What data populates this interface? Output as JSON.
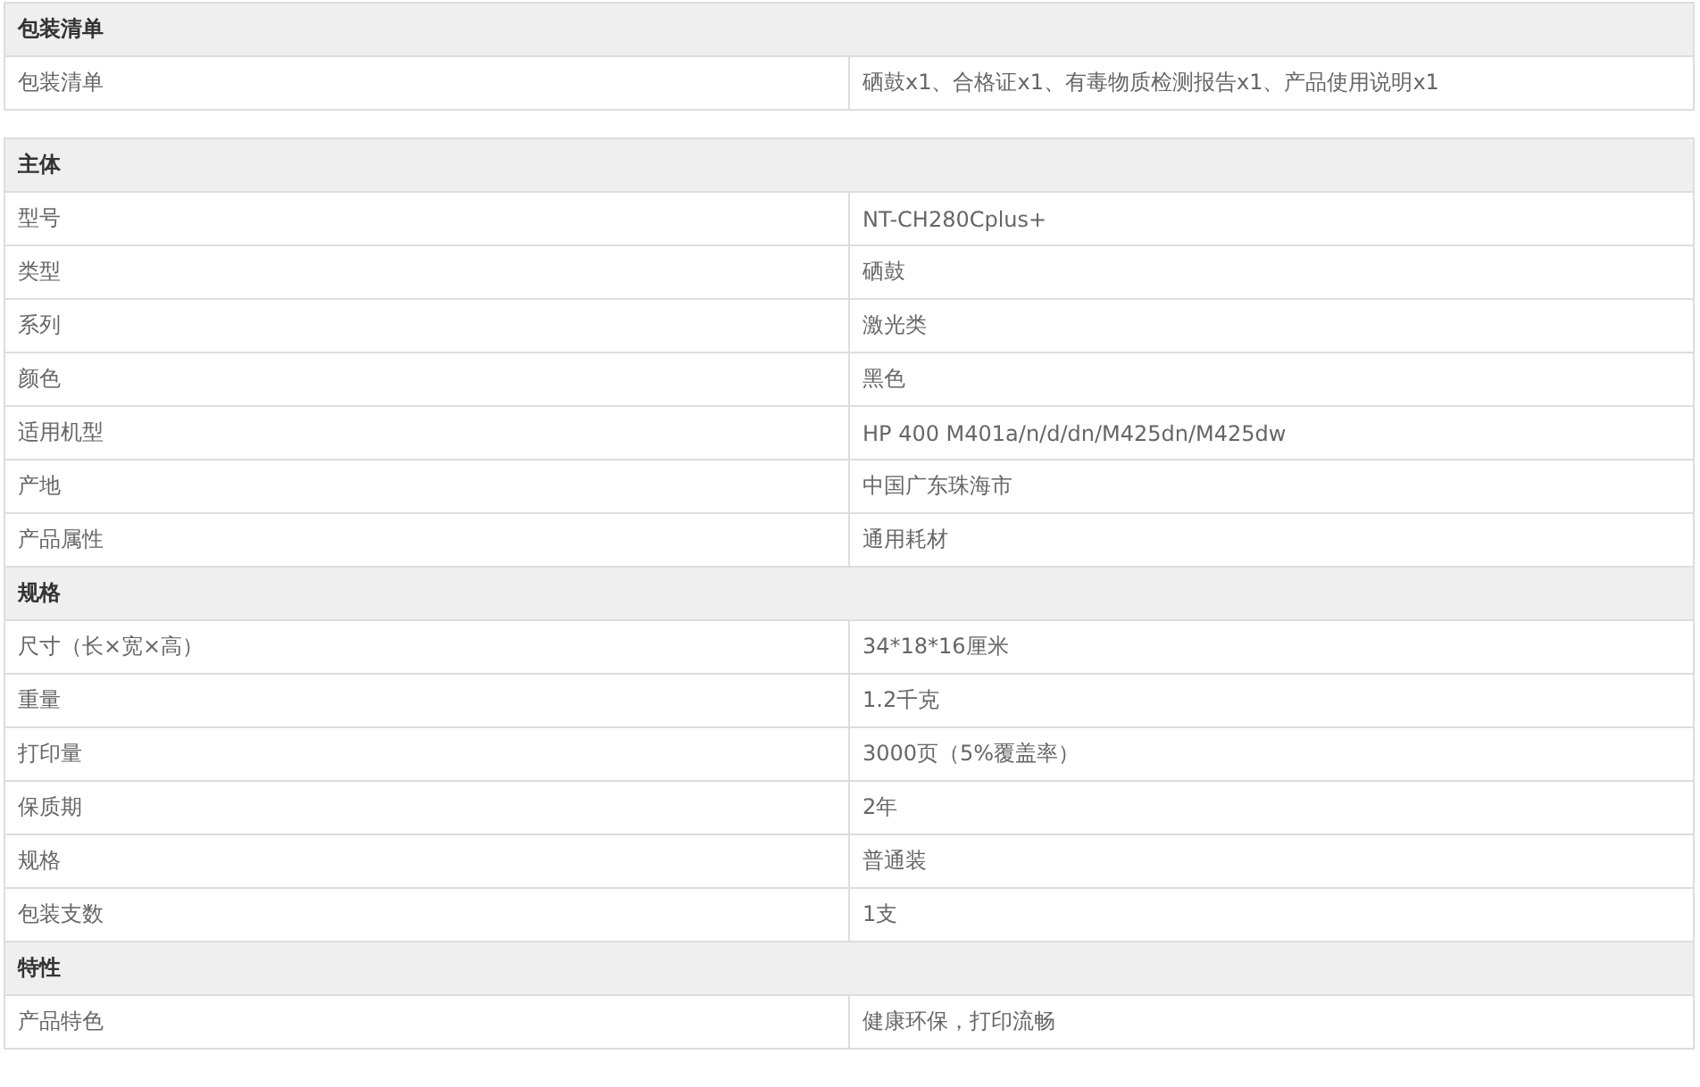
{
  "tables": [
    {
      "sections": [
        {
          "title": "包装清单",
          "rows": [
            {
              "label": "包装清单",
              "value": "硒鼓x1、合格证x1、有毒物质检测报告x1、产品使用说明x1"
            }
          ]
        }
      ]
    },
    {
      "sections": [
        {
          "title": "主体",
          "rows": [
            {
              "label": "型号",
              "value": "NT-CH280Cplus+"
            },
            {
              "label": "类型",
              "value": "硒鼓"
            },
            {
              "label": "系列",
              "value": "激光类"
            },
            {
              "label": "颜色",
              "value": "黑色"
            },
            {
              "label": "适用机型",
              "value": "HP 400 M401a/n/d/dn/M425dn/M425dw"
            },
            {
              "label": "产地",
              "value": "中国广东珠海市"
            },
            {
              "label": "产品属性",
              "value": "通用耗材"
            }
          ]
        },
        {
          "title": "规格",
          "rows": [
            {
              "label": "尺寸（长×宽×高）",
              "value": "34*18*16厘米"
            },
            {
              "label": "重量",
              "value": "1.2千克"
            },
            {
              "label": "打印量",
              "value": "3000页（5%覆盖率）"
            },
            {
              "label": "保质期",
              "value": "2年"
            },
            {
              "label": "规格",
              "value": "普通装"
            },
            {
              "label": "包装支数",
              "value": "1支"
            }
          ]
        },
        {
          "title": "特性",
          "rows": [
            {
              "label": "产品特色",
              "value": "健康环保，打印流畅"
            }
          ]
        }
      ]
    }
  ]
}
